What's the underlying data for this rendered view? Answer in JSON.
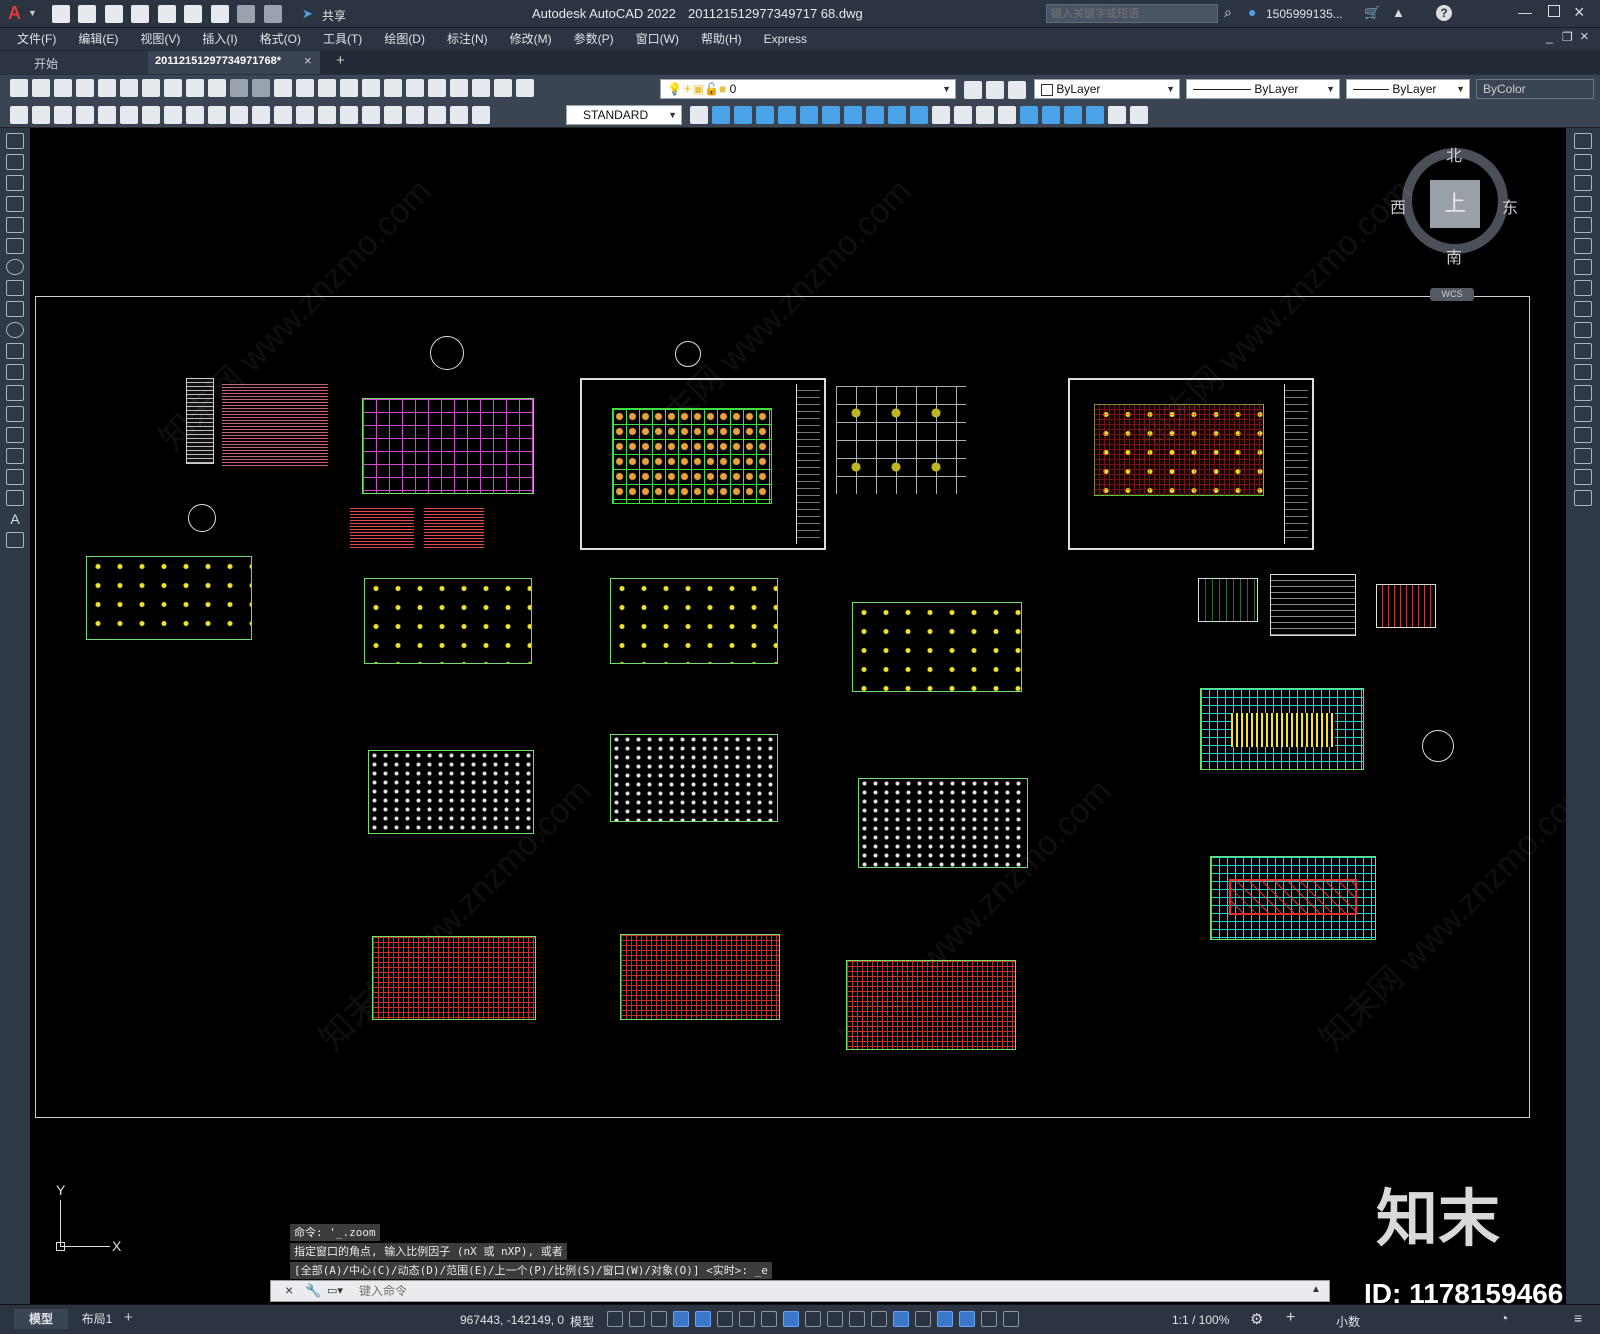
{
  "app": {
    "title": "Autodesk AutoCAD 2022",
    "filename": "201121512977349717 68.dwg",
    "share_label": "共享",
    "search_placeholder": "键入关键字或短语",
    "user": "1505999135...",
    "logo_letter": "A"
  },
  "menu": [
    "文件(F)",
    "编辑(E)",
    "视图(V)",
    "插入(I)",
    "格式(O)",
    "工具(T)",
    "绘图(D)",
    "标注(N)",
    "修改(M)",
    "参数(P)",
    "窗口(W)",
    "帮助(H)",
    "Express"
  ],
  "tabs": [
    {
      "label": "开始"
    },
    {
      "label": "20112151297734971768*"
    }
  ],
  "toolbar": {
    "layer_value": "0",
    "color_value": "ByLayer",
    "linetype_value": "ByLayer",
    "lineweight_value": "ByLayer",
    "plotstyle_value": "ByColor",
    "textstyle_value": "STANDARD"
  },
  "viewcube": {
    "north": "北",
    "south": "南",
    "east": "东",
    "west": "西",
    "top": "上",
    "wcs": "WCS"
  },
  "ucs": {
    "x": "X",
    "y": "Y"
  },
  "command": {
    "history": [
      "命令: '_.zoom",
      "指定窗口的角点, 输入比例因子 (nX 或 nXP), 或者",
      "[全部(A)/中心(C)/动态(D)/范围(E)/上一个(P)/比例(S)/窗口(W)/对象(O)] <实时>: _e"
    ],
    "placeholder": "键入命令"
  },
  "watermark": {
    "brand": "知末",
    "id": "ID: 1178159466",
    "diagonal": "知末网 www.znzmo.com"
  },
  "layout_tabs": [
    "模型",
    "布局1"
  ],
  "status": {
    "coords": "967443, -142149, 0",
    "mode": "模型",
    "scale": "1:1 / 100%",
    "units": "小数"
  }
}
